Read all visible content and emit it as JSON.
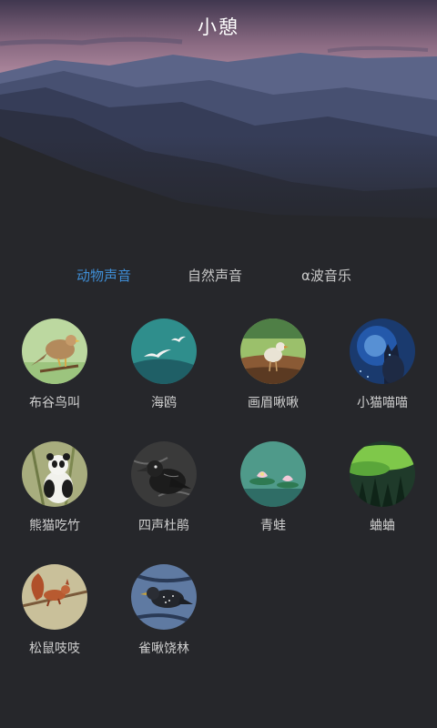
{
  "header": {
    "title": "小憩"
  },
  "tabs": [
    {
      "label": "动物声音",
      "active": true
    },
    {
      "label": "自然声音",
      "active": false
    },
    {
      "label": "α波音乐",
      "active": false
    }
  ],
  "sounds": [
    {
      "label": "布谷鸟叫",
      "icon": "cuckoo-bird-icon"
    },
    {
      "label": "海鸥",
      "icon": "seagull-icon"
    },
    {
      "label": "画眉啾啾",
      "icon": "thrush-bird-icon"
    },
    {
      "label": "小猫喵喵",
      "icon": "kitten-icon"
    },
    {
      "label": "熊猫吃竹",
      "icon": "panda-icon"
    },
    {
      "label": "四声杜鹃",
      "icon": "crow-bird-icon"
    },
    {
      "label": "青蛙",
      "icon": "lotus-pond-icon"
    },
    {
      "label": "蛐蛐",
      "icon": "forest-icon"
    },
    {
      "label": "松鼠吱吱",
      "icon": "squirrel-icon"
    },
    {
      "label": "雀啾饶林",
      "icon": "sparrow-icon"
    }
  ],
  "colors": {
    "background": "#26272b",
    "active_tab": "#3f8ed6",
    "text": "#cfcfcf"
  }
}
